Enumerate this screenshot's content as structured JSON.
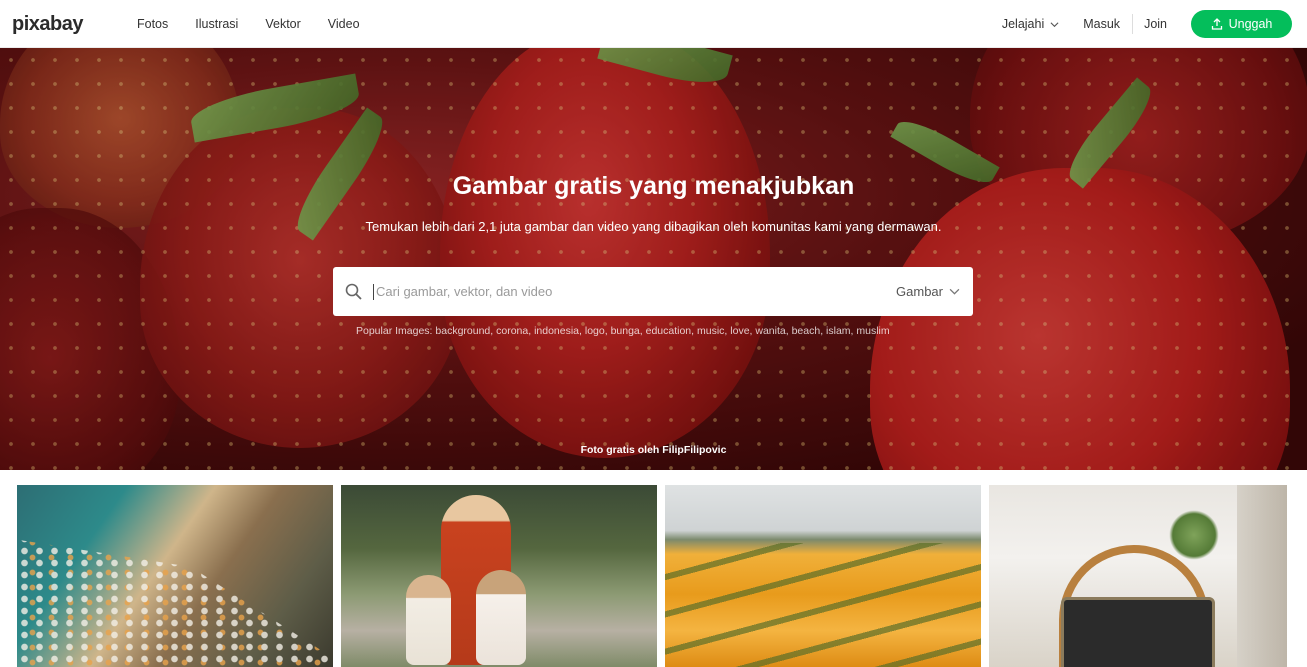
{
  "header": {
    "logo": "pixabay",
    "nav": [
      "Fotos",
      "Ilustrasi",
      "Vektor",
      "Video"
    ],
    "explore": "Jelajahi",
    "login": "Masuk",
    "join": "Join",
    "upload": "Unggah"
  },
  "hero": {
    "title": "Gambar gratis yang menakjubkan",
    "subtitle": "Temukan lebih dari 2,1 juta gambar dan video yang dibagikan oleh komunitas kami yang dermawan.",
    "search": {
      "placeholder": "Cari gambar, vektor, dan video",
      "value": "",
      "type": "Gambar"
    },
    "popular_label": "Popular Images:",
    "popular_tags": [
      "background",
      "corona",
      "indonesia",
      "logo",
      "bunga",
      "education",
      "music",
      "love",
      "wanita",
      "beach",
      "islam",
      "muslim"
    ],
    "credit": "Foto gratis oleh FilipFilipovic"
  },
  "colors": {
    "accent": "#04be5b",
    "text": "#333333"
  },
  "icons": {
    "search": "search-icon",
    "upload": "upload-icon",
    "chevron": "chevron-down-icon"
  }
}
